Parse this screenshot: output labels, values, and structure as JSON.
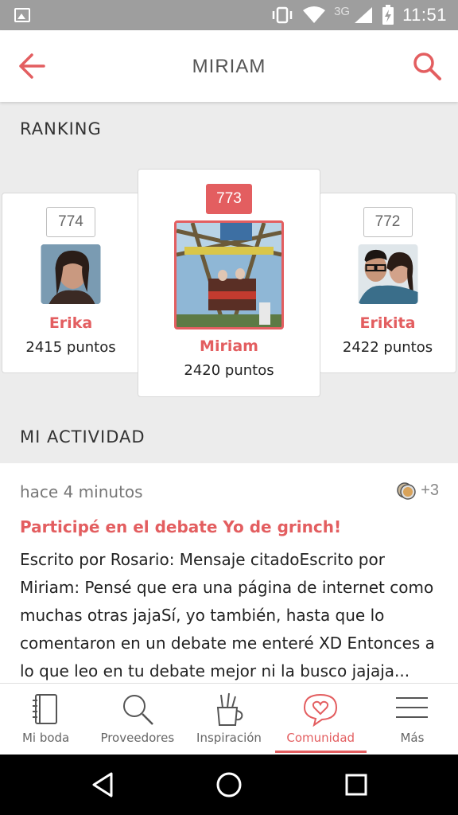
{
  "status_bar": {
    "network": "3G",
    "time": "11:51"
  },
  "header": {
    "title": "MIRIAM"
  },
  "ranking": {
    "section_title": "RANKING",
    "entries": [
      {
        "rank": "774",
        "name": "Erika",
        "points": "2415 puntos"
      },
      {
        "rank": "773",
        "name": "Miriam",
        "points": "2420 puntos"
      },
      {
        "rank": "772",
        "name": "Erikita",
        "points": "2422 puntos"
      }
    ]
  },
  "activity": {
    "section_title": "MI ACTIVIDAD",
    "time": "hace 4 minutos",
    "count": "+3",
    "title": "Participé en el debate Yo de grinch!",
    "body": "Escrito por Rosario: Mensaje citadoEscrito por Miriam: Pensé que era una página de internet como muchas otras jajaSí, yo también, hasta que lo comentaron en un debate me enteré XD Entonces a lo que leo en tu debate mejor ni la busco jajaja..."
  },
  "bottom_nav": {
    "items": [
      {
        "label": "Mi boda"
      },
      {
        "label": "Proveedores"
      },
      {
        "label": "Inspiración"
      },
      {
        "label": "Comunidad"
      },
      {
        "label": "Más"
      }
    ]
  },
  "colors": {
    "accent": "#e35e60",
    "status_bar": "#9e9e9e",
    "background": "#ececec"
  }
}
